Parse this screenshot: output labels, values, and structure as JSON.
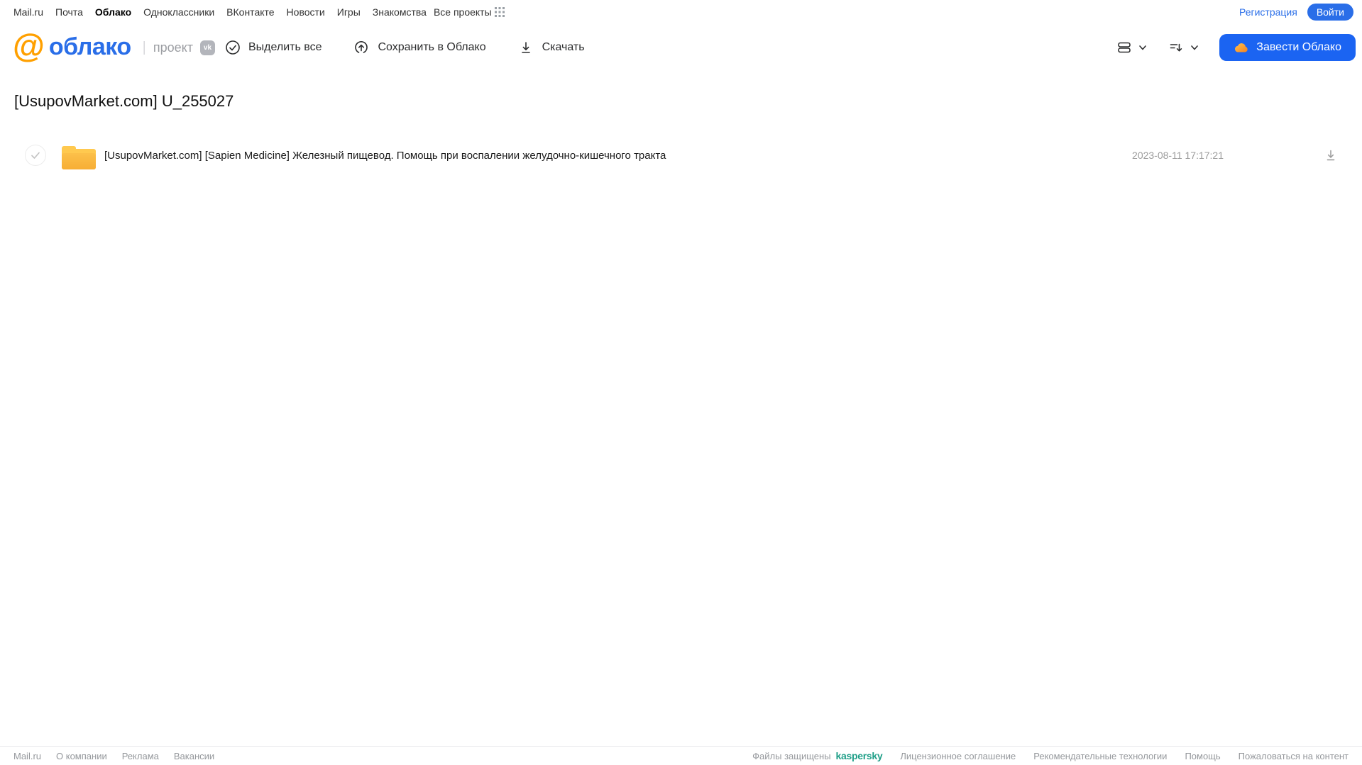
{
  "topbar": {
    "links": [
      {
        "label": "Mail.ru"
      },
      {
        "label": "Почта"
      },
      {
        "label": "Облако"
      },
      {
        "label": "Одноклассники"
      },
      {
        "label": "ВКонтакте"
      },
      {
        "label": "Новости"
      },
      {
        "label": "Знакомства"
      },
      {
        "label": "Игры"
      },
      {
        "label": "Все проекты"
      }
    ],
    "registration_label": "Регистрация",
    "login_label": "Войти"
  },
  "header": {
    "logo_text": "облако",
    "project_label": "проект",
    "vk_badge": "vk",
    "toolbar": {
      "select_all": "Выделить все",
      "save_to_cloud": "Сохранить в Облако",
      "download": "Скачать"
    },
    "get_cloud_label": "Завести Облако"
  },
  "main": {
    "title": "[UsupovMarket.com] U_255027",
    "files": [
      {
        "type": "folder",
        "name": "[UsupovMarket.com] [Sapien Medicine] Железный пищевод. Помощь при воспалении желудочно-кишечного тракта",
        "date": "2023-08-11 17:17:21"
      }
    ]
  },
  "footer": {
    "left_links": [
      "Mail.ru",
      "О компании",
      "Реклама",
      "Вакансии"
    ],
    "protected_label": "Файлы защищены",
    "kaspersky_label": "kaspersky",
    "right_links": [
      "Лицензионное соглашение",
      "Рекомендательные технологии",
      "Помощь",
      "Пожаловаться на контент"
    ]
  },
  "colors": {
    "accent_blue": "#1b64f2",
    "logo_orange": "#ffa000",
    "folder_yellow": "#fbbc42",
    "kaspersky_teal": "#1e9e87",
    "muted_gray": "#9b9da2"
  }
}
